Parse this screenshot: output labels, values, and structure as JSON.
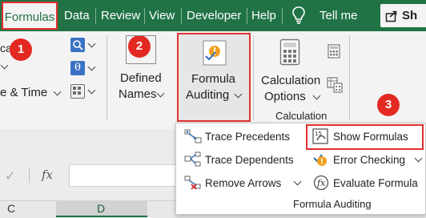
{
  "tabs": [
    "Formulas",
    "Data",
    "Review",
    "View",
    "Developer",
    "Help",
    "Tell me",
    "Sh"
  ],
  "tell_me_icon": "lightbulb-icon",
  "ribbon": {
    "partial_label_1": "ca",
    "partial_label_2": "e & Time",
    "defined_names": [
      "Defined",
      "Names"
    ],
    "formula_auditing": [
      "Formula",
      "Auditing"
    ],
    "calculation_options": [
      "Calculation",
      "Options"
    ],
    "calculation_group": "Calculation"
  },
  "badges": [
    "1",
    "2",
    "3"
  ],
  "dropdown": {
    "trace_precedents": "Trace Precedents",
    "trace_dependents": "Trace Dependents",
    "remove_arrows": "Remove Arrows",
    "show_formulas": "Show Formulas",
    "error_checking": "Error Checking",
    "evaluate_formula": "Evaluate Formula",
    "group_label": "Formula Auditing"
  },
  "formula_bar": {
    "fx": "fx"
  },
  "columns": [
    "C",
    "D"
  ],
  "colors": {
    "excel_green": "#217346",
    "highlight_red": "#e03030",
    "badge_red": "#e32a22"
  }
}
